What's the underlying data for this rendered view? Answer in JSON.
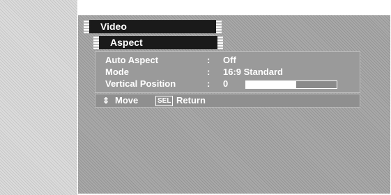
{
  "menu": {
    "title": "Video",
    "submenu_title": "Aspect"
  },
  "settings": [
    {
      "label": "Auto Aspect",
      "colon": ":",
      "value": "Off"
    },
    {
      "label": "Mode",
      "colon": ":",
      "value": "16:9 Standard"
    },
    {
      "label": "Vertical Position",
      "colon": ":",
      "value": "0",
      "slider_level": 0.55
    }
  ],
  "footer": {
    "move_icon": "updown-arrows-icon",
    "move_label": "Move",
    "sel_key": "SEL",
    "return_label": "Return"
  },
  "colors": {
    "panel": "#a9a9a9",
    "bar": "#1a1a1a",
    "text": "#ffffff"
  }
}
